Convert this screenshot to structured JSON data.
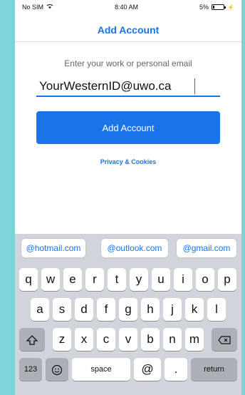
{
  "status_bar": {
    "carrier": "No SIM",
    "time": "8:40 AM",
    "battery": "5%"
  },
  "header": {
    "title": "Add Account"
  },
  "form": {
    "prompt": "Enter your work or personal email",
    "email_value": "YourWesternID@uwo.ca",
    "submit_label": "Add Account",
    "privacy_label": "Privacy & Cookies"
  },
  "suggestions": [
    "@hotmail.com",
    "@outlook.com",
    "@gmail.com"
  ],
  "keyboard": {
    "row1": [
      "q",
      "w",
      "e",
      "r",
      "t",
      "y",
      "u",
      "i",
      "o",
      "p"
    ],
    "row2": [
      "a",
      "s",
      "d",
      "f",
      "g",
      "h",
      "j",
      "k",
      "l"
    ],
    "row3": [
      "z",
      "x",
      "c",
      "v",
      "b",
      "n",
      "m"
    ],
    "shift_icon": "shift-icon",
    "backspace_icon": "backspace-icon",
    "numbers_label": "123",
    "emoji_icon": "emoji-icon",
    "space_label": "space",
    "at_label": "@",
    "dot_label": ".",
    "return_label": "return"
  },
  "colors": {
    "accent": "#1a73e8",
    "background": "#7fd3d8"
  }
}
